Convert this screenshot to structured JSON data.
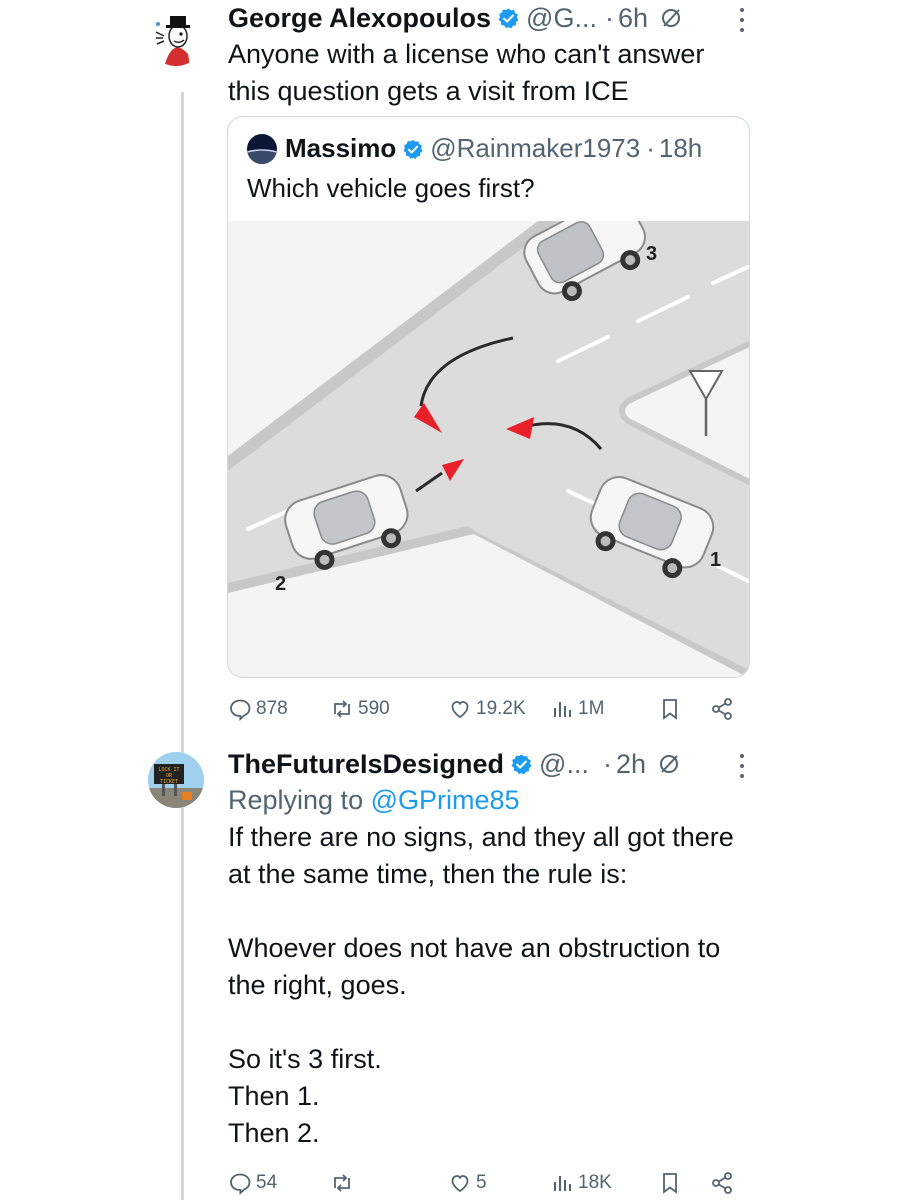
{
  "tweet1": {
    "name": "George Alexopoulos",
    "handle": "@G...",
    "time": "6h",
    "text": "Anyone with a license who can't answer this question gets a visit from ICE",
    "quote": {
      "name": "Massimo",
      "handle": "@Rainmaker1973",
      "time": "18h",
      "text": "Which vehicle goes first?",
      "image": {
        "car_labels": [
          "3",
          "2",
          "1"
        ]
      }
    },
    "stats": {
      "replies": "878",
      "reposts": "590",
      "likes": "19.2K",
      "views": "1M"
    }
  },
  "tweet2": {
    "name": "TheFutureIsDesigned",
    "handle": "@...",
    "time": "2h",
    "replying_prefix": "Replying to ",
    "replying_to": "@GPrime85",
    "text": "If there are no signs, and they all got there at the same time, then the rule is:\n\nWhoever does not have an obstruction to the right, goes.\n\nSo it's 3 first.\nThen 1.\nThen 2.",
    "avatar_sign": [
      "LOCK IT",
      "OR",
      "TICKET"
    ],
    "stats": {
      "replies": "54",
      "reposts": "",
      "likes": "5",
      "views": "18K"
    }
  },
  "colors": {
    "verified": "#1d9bf0",
    "secondary_text": "#536471",
    "link": "#1d9bf0",
    "thread_line": "#cfd9de",
    "arrow_red": "#e8202a"
  }
}
